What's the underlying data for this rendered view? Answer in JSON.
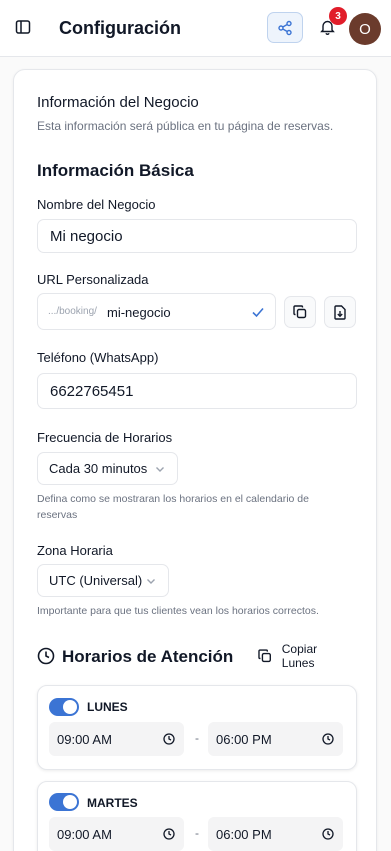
{
  "header": {
    "title": "Configuración",
    "notification_count": "3",
    "avatar_initial": "O"
  },
  "business_info": {
    "title": "Información del Negocio",
    "description": "Esta información será pública en tu página de reservas.",
    "basic_title": "Información Básica",
    "name_label": "Nombre del Negocio",
    "name_value": "Mi negocio",
    "url_label": "URL Personalizada",
    "url_prefix": ".../booking/",
    "url_value": "mi-negocio",
    "phone_label": "Teléfono (WhatsApp)",
    "phone_value": "6622765451",
    "frequency_label": "Frecuencia de Horarios",
    "frequency_value": "Cada 30 minutos",
    "frequency_hint": "Defina como se mostraran los horarios en el calendario de reservas",
    "timezone_label": "Zona Horaria",
    "timezone_value": "UTC (Universal)",
    "timezone_hint": "Importante para que tus clientes vean los horarios correctos."
  },
  "hours": {
    "title": "Horarios de Atención",
    "copy_label": "Copiar Lunes",
    "separator": "-",
    "days": [
      {
        "name": "LUNES",
        "enabled": true,
        "start": "09:00 AM",
        "end": "06:00 PM"
      },
      {
        "name": "MARTES",
        "enabled": true,
        "start": "09:00 AM",
        "end": "06:00 PM"
      }
    ]
  },
  "colors": {
    "accent": "#3b74d4",
    "badge": "#e11d2a",
    "avatar_bg": "#6b3b2c"
  },
  "icons": {
    "sidebar": "sidebar-toggle-icon",
    "share": "share-icon",
    "bell": "bell-icon",
    "check": "check-icon",
    "copy": "copy-icon",
    "download": "download-icon",
    "chevron": "chevron-down-icon",
    "clock": "clock-icon"
  }
}
